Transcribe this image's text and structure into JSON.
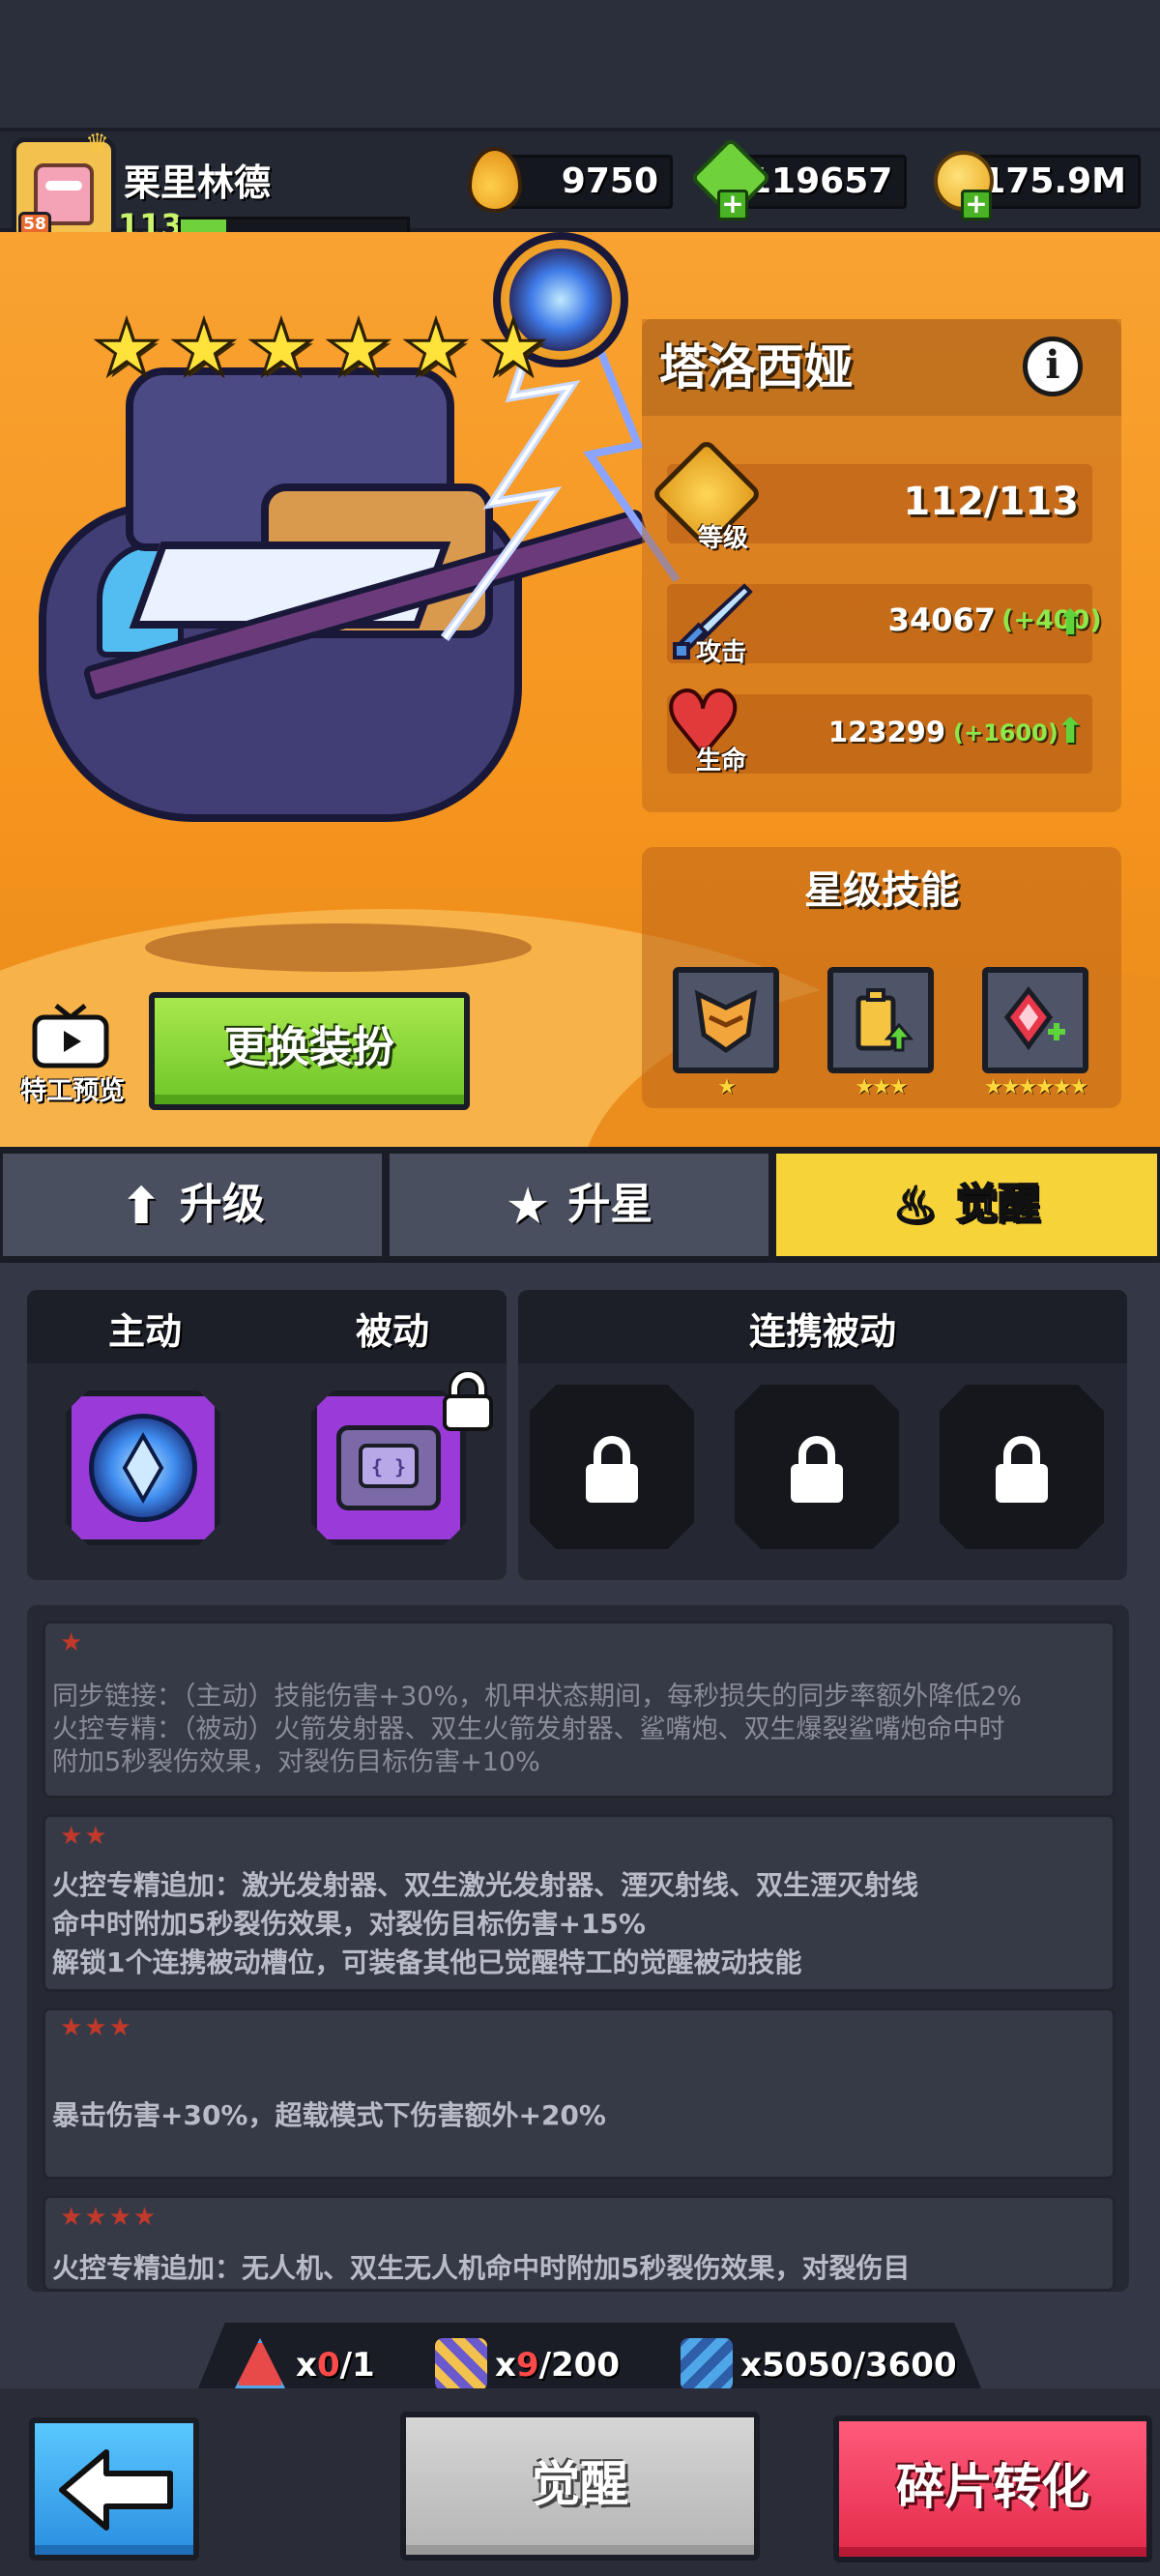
{
  "player": {
    "avatar_level": "58",
    "name": "栗里林德",
    "level": "113",
    "xp_fraction": 0.2
  },
  "resources": {
    "oil": "9750",
    "gems": "119657",
    "coins": "175.9M"
  },
  "hero": {
    "stars": 6,
    "name": "塔洛西娅",
    "info_icon": "i",
    "level_label": "等级",
    "level_value": "112/113",
    "attack_label": "攻击",
    "attack_value": "34067",
    "attack_increase": "(+400)",
    "hp_label": "生命",
    "hp_value": "123299",
    "hp_increase": "(+1600)"
  },
  "star_skills": {
    "title": "星级技能",
    "slots": [
      {
        "icon": "helmet-icon",
        "stars": "★"
      },
      {
        "icon": "battery-upgrade-icon",
        "stars": "★★★"
      },
      {
        "icon": "crit-gem-icon",
        "stars": "★★★★★★"
      }
    ]
  },
  "preview": {
    "label": "特工预览",
    "icon": "tv-icon"
  },
  "dress_button": "更换装扮",
  "tabs": [
    {
      "label": "升级",
      "icon": "arrow-up-icon",
      "active": false
    },
    {
      "label": "升星",
      "icon": "star-icon",
      "active": false
    },
    {
      "label": "觉醒",
      "icon": "flame-icon",
      "active": true
    }
  ],
  "awaken": {
    "active_label": "主动",
    "passive_label": "被动",
    "link_label": "连携被动"
  },
  "descriptions": [
    {
      "stars": "★",
      "lines": [
        "同步链接：（主动）技能伤害+30%，机甲状态期间，每秒损失的同步率额外降低2%",
        "火控专精：（被动）火箭发射器、双生火箭发射器、鲨嘴炮、双生爆裂鲨嘴炮命中时",
        "附加5秒裂伤效果，对裂伤目标伤害+10%"
      ]
    },
    {
      "stars": "★★",
      "lines": [
        "火控专精追加：激光发射器、双生激光发射器、湮灭射线、双生湮灭射线",
        "命中时附加5秒裂伤效果，对裂伤目标伤害+15%",
        "解锁1个连携被动槽位，可装备其他已觉醒特工的觉醒被动技能"
      ]
    },
    {
      "stars": "★★★",
      "lines": [
        "暴击伤害+30%，超载模式下伤害额外+20%"
      ]
    },
    {
      "stars": "★★★★",
      "lines": [
        "火控专精追加：无人机、双生无人机命中时附加5秒裂伤效果，对裂伤目"
      ]
    }
  ],
  "costs": [
    {
      "icon": "awaken-crystal-icon",
      "prefix": "x",
      "have": "0",
      "need": "/1"
    },
    {
      "icon": "shard-icon",
      "prefix": "x",
      "have": "9",
      "need": "/200"
    },
    {
      "icon": "blue-shard-icon",
      "prefix": "x",
      "have": "5050",
      "need": "/3600"
    }
  ],
  "buttons": {
    "back": "back-arrow-icon",
    "awaken": "觉醒",
    "convert": "碎片转化"
  }
}
